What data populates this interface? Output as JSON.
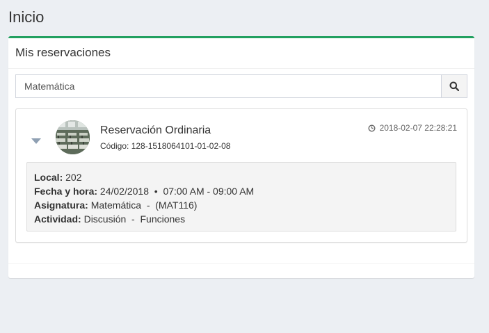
{
  "page": {
    "title": "Inicio"
  },
  "box": {
    "title": "Mis reservaciones",
    "accent_color": "#22a060"
  },
  "search": {
    "value": "Matemática",
    "icon": "search-icon"
  },
  "reservation": {
    "title": "Reservación Ordinaria",
    "code": "Código: 128-1518064101-01-02-08",
    "timestamp": "2018-02-07 22:28:21",
    "details": {
      "local_label": "Local:",
      "local_value": "202",
      "fecha_label": "Fecha y hora:",
      "fecha_value": "24/02/2018  •  07:00 AM - 09:00 AM",
      "asignatura_label": "Asignatura:",
      "asignatura_value": "Matemática  -  (MAT116)",
      "actividad_label": "Actividad:",
      "actividad_value": "Discusión  -  Funciones"
    }
  }
}
